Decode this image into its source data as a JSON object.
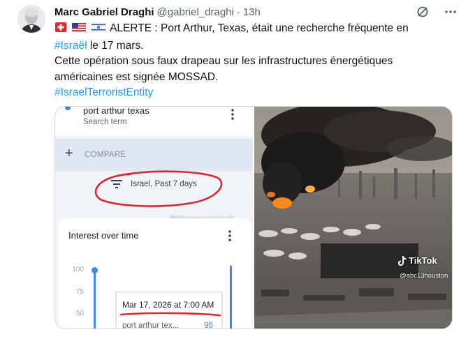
{
  "author": {
    "name": "Marc Gabriel Draghi",
    "handle": "@gabriel_draghi",
    "separator": "·",
    "time": "13h"
  },
  "icons": {
    "grok": "grok-icon",
    "more": "more-horizontal-icon",
    "flags": [
      "swiss-flag-icon",
      "us-flag-icon",
      "israel-flag-icon"
    ]
  },
  "tweet": {
    "line1_text": "ALERTE : Port Arthur, Texas, était une recherche fréquente en",
    "line2_hashtag": "#Israël",
    "line2_text": " le 17 mars.",
    "line3_text": "Cette opération sous faux drapeau sur les infrastructures énergétiques",
    "line4_text": "américaines est signée MOSSAD.",
    "line5_hashtag": "#IsraelTerroristEntity"
  },
  "media_left": {
    "search_term": "port arthur texas",
    "search_subtitle": "Search term",
    "compare_label": "COMPARE",
    "filter_text": "Israel, Past 7 days",
    "watermark": "@CheesecakeMufti",
    "card_title": "Interest over time",
    "axis_labels": [
      "100",
      "75",
      "50"
    ],
    "tooltip_date": "Mar 17, 2026 at 7:00 AM",
    "tooltip_term": "port arthur tex...",
    "tooltip_value": "96"
  },
  "media_right": {
    "tiktok_label": "TikTok",
    "tiktok_handle": "@abc13houston"
  },
  "colors": {
    "accent": "#1d9bf0",
    "text": "#0f1419",
    "muted": "#536471",
    "trends_blue": "#4285f4",
    "annotation_red": "#e0262c"
  }
}
